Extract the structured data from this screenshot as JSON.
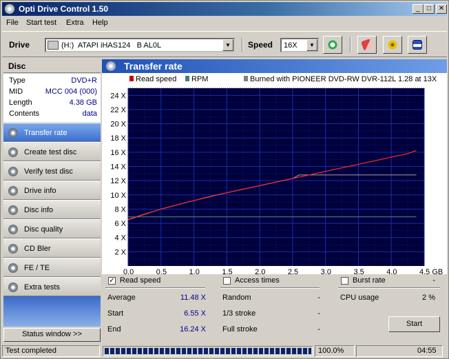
{
  "window": {
    "title": "Opti Drive Control 1.50",
    "btn_min": "_",
    "btn_max": "□",
    "btn_close": "✕"
  },
  "menu": [
    "File",
    "Start test",
    "Extra",
    "Help"
  ],
  "toolbar": {
    "drive_label": "Drive",
    "drive_value": "(H:)  ATAPI iHAS124   B AL0L",
    "speed_label": "Speed",
    "speed_value": "16X"
  },
  "disc": {
    "header": "Disc",
    "rows": [
      {
        "key": "Type",
        "value": "DVD+R"
      },
      {
        "key": "MID",
        "value": "MCC 004 (000)"
      },
      {
        "key": "Length",
        "value": "4.38 GB"
      },
      {
        "key": "Contents",
        "value": "data"
      }
    ]
  },
  "nav": [
    {
      "label": "Transfer rate",
      "active": true
    },
    {
      "label": "Create test disc",
      "active": false
    },
    {
      "label": "Verify test disc",
      "active": false
    },
    {
      "label": "Drive info",
      "active": false
    },
    {
      "label": "Disc info",
      "active": false
    },
    {
      "label": "Disc quality",
      "active": false
    },
    {
      "label": "CD Bler",
      "active": false
    },
    {
      "label": "FE / TE",
      "active": false
    },
    {
      "label": "Extra tests",
      "active": false
    }
  ],
  "status_window_label": "Status window >>",
  "panel_title": "Transfer rate",
  "chart_data": {
    "type": "line",
    "legend": [
      {
        "name": "Read speed",
        "color": "#cc0000"
      },
      {
        "name": "RPM",
        "color": "#4a7d7d"
      },
      {
        "name": "Burned with PIONEER DVD-RW  DVR-112L 1.28 at 13X",
        "color": "#808080"
      }
    ],
    "x_ticks": [
      "0.0",
      "0.5",
      "1.0",
      "1.5",
      "2.0",
      "2.5",
      "3.0",
      "3.5",
      "4.0",
      "4.5 GB"
    ],
    "y_ticks": [
      "2 X",
      "4 X",
      "6 X",
      "8 X",
      "10 X",
      "12 X",
      "14 X",
      "16 X",
      "18 X",
      "20 X",
      "22 X",
      "24 X"
    ],
    "xlim": [
      0,
      4.5
    ],
    "ylim": [
      0,
      25
    ],
    "grid": true,
    "background": "#00003c",
    "series": [
      {
        "name": "Read speed",
        "x": [
          0.0,
          0.25,
          0.5,
          0.75,
          1.0,
          1.25,
          1.5,
          1.75,
          2.0,
          2.25,
          2.5,
          2.75,
          3.0,
          3.25,
          3.5,
          3.75,
          4.0,
          4.25,
          4.38
        ],
        "y": [
          6.55,
          7.3,
          8.0,
          8.6,
          9.2,
          9.8,
          10.3,
          10.8,
          11.3,
          11.8,
          12.3,
          12.8,
          13.3,
          13.8,
          14.3,
          14.8,
          15.3,
          15.8,
          16.24
        ]
      },
      {
        "name": "RPM",
        "x": [
          0.0,
          4.38
        ],
        "y": [
          6.9,
          6.9
        ]
      },
      {
        "name": "Burned with PIONEER DVD-RW  DVR-112L 1.28 at 13X",
        "x": [
          0.0,
          0.5,
          1.0,
          1.5,
          2.0,
          2.5,
          2.6,
          3.0,
          3.5,
          4.0,
          4.38
        ],
        "y": [
          6.5,
          8.0,
          9.2,
          10.3,
          11.3,
          12.3,
          12.8,
          12.8,
          12.8,
          12.8,
          12.8
        ]
      }
    ]
  },
  "stats": {
    "read_speed_label": "Read speed",
    "read_speed_checked": "✓",
    "access_times_label": "Access times",
    "burst_rate_label": "Burst rate",
    "burst_rate_value": "-",
    "average_label": "Average",
    "average_value": "11.48 X",
    "start_label": "Start",
    "start_value": "6.55 X",
    "end_label": "End",
    "end_value": "16.24 X",
    "random_label": "Random",
    "random_value": "-",
    "third_label": "1/3 stroke",
    "third_value": "-",
    "full_label": "Full stroke",
    "full_value": "-",
    "cpu_label": "CPU usage",
    "cpu_value": "2 %",
    "start_button": "Start"
  },
  "statusbar": {
    "text": "Test completed",
    "progress": 1.0,
    "percent": "100.0%",
    "time": "04:55"
  }
}
